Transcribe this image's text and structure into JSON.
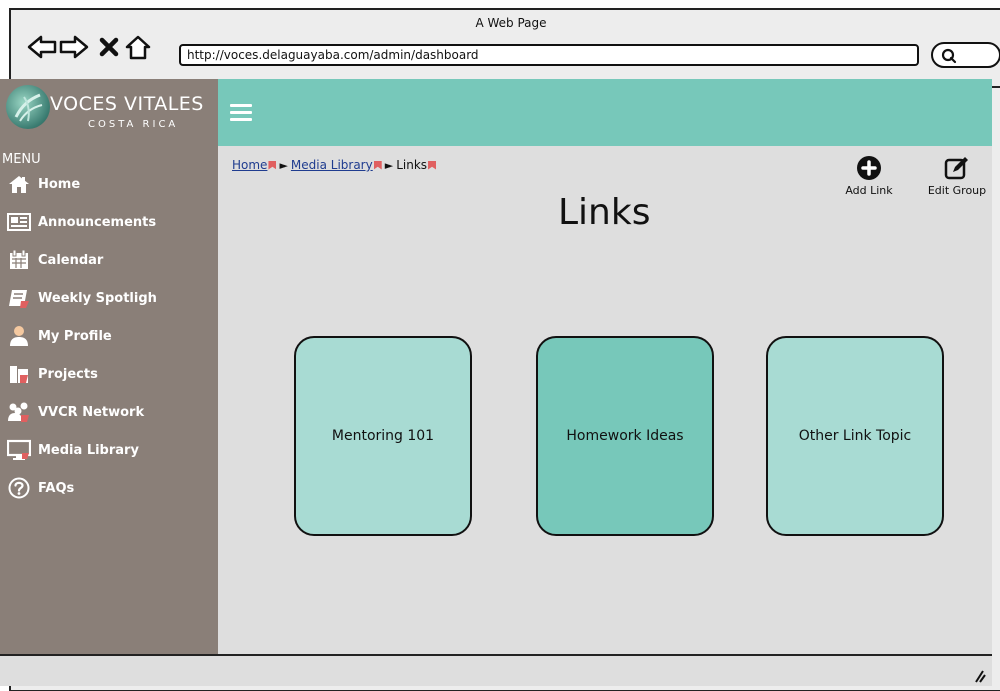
{
  "browser": {
    "title": "A Web Page",
    "url": "http://voces.delaguayaba.com/admin/dashboard"
  },
  "brand": {
    "name": "VOCES VITALES",
    "subtitle": "COSTA RICA",
    "logo_icon": "voces-vitales-logo"
  },
  "sidebar": {
    "menu_title": "MENU",
    "items": [
      {
        "label": "Home",
        "icon": "home-icon"
      },
      {
        "label": "Announcements",
        "icon": "newspaper-icon"
      },
      {
        "label": "Calendar",
        "icon": "calendar-icon"
      },
      {
        "label": "Weekly Spotligh",
        "icon": "book-icon"
      },
      {
        "label": "My Profile",
        "icon": "user-icon"
      },
      {
        "label": "Projects",
        "icon": "projects-icon"
      },
      {
        "label": "VVCR Network",
        "icon": "network-icon"
      },
      {
        "label": "Media Library",
        "icon": "monitor-icon"
      },
      {
        "label": "FAQs",
        "icon": "question-icon"
      }
    ]
  },
  "breadcrumb": {
    "home": "Home",
    "media_library": "Media Library",
    "current": "Links"
  },
  "main": {
    "title": "Links",
    "add_link_label": "Add Link",
    "edit_group_label": "Edit Group"
  },
  "cards": [
    {
      "label": "Mentoring 101",
      "color": "#a8dbd3"
    },
    {
      "label": "Homework Ideas",
      "color": "#77c8ba"
    },
    {
      "label": "Other Link Topic",
      "color": "#a8dbd3"
    }
  ],
  "colors": {
    "accent_teal": "#77c8ba",
    "sidebar_bg": "#8a7f78",
    "content_bg": "#dedede",
    "link_blue": "#1f3c8f"
  }
}
